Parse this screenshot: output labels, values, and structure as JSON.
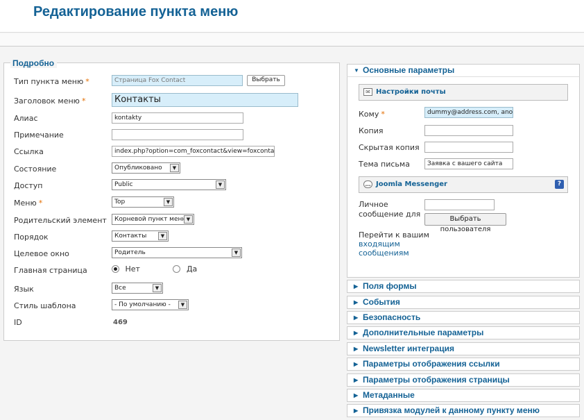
{
  "page": {
    "title": "Редактирование пункта меню"
  },
  "details": {
    "legend": "Подробно",
    "fields": {
      "type_label": "Тип пункта меню",
      "type_value": "Страница Fox Contact",
      "type_button": "Выбрать",
      "title_label": "Заголовок меню",
      "title_value": "Контакты",
      "alias_label": "Алиас",
      "alias_value": "kontakty",
      "note_label": "Примечание",
      "note_value": "",
      "link_label": "Ссылка",
      "link_value": "index.php?option=com_foxcontact&view=foxcontact",
      "state_label": "Состояние",
      "state_value": "Опубликовано",
      "access_label": "Доступ",
      "access_value": "Public",
      "menu_label": "Меню",
      "menu_value": "Top",
      "parent_label": "Родительский элемент",
      "parent_value": "Корневой пункт меню",
      "order_label": "Порядок",
      "order_value": "Контакты",
      "target_label": "Целевое окно",
      "target_value": "Родитель",
      "home_label": "Главная страница",
      "home_no": "Нет",
      "home_yes": "Да",
      "lang_label": "Язык",
      "lang_value": "Все",
      "style_label": "Стиль шаблона",
      "style_value": "- По умолчанию -",
      "id_label": "ID",
      "id_value": "469"
    },
    "required_mark": "*"
  },
  "right": {
    "main_title": "Основные параметры",
    "mail_settings": "Настройки почты",
    "to_label": "Кому",
    "to_value": "dummy@address.com, anothe",
    "cc_label": "Копия",
    "bcc_label": "Скрытая копия",
    "subject_label": "Тема письма",
    "subject_value": "Заявка с вашего сайта",
    "messenger_title": "Joomla Messenger",
    "help": "?",
    "pm_label_1": "Личное",
    "pm_label_2": "сообщение для",
    "pm_button": "Выбрать пользователя",
    "inbox_text": "Перейти к вашим",
    "inbox_link_1": "входящим",
    "inbox_link_2": "сообщениям",
    "sections": [
      "Поля формы",
      "События",
      "Безопасность",
      "Дополнительные параметры",
      "Newsletter интеграция",
      "Параметры отображения ссылки",
      "Параметры отображения страницы",
      "Метаданные",
      "Привязка модулей к данному пункту меню"
    ]
  },
  "colors": {
    "accent": "#146295",
    "required": "#e36d00"
  }
}
